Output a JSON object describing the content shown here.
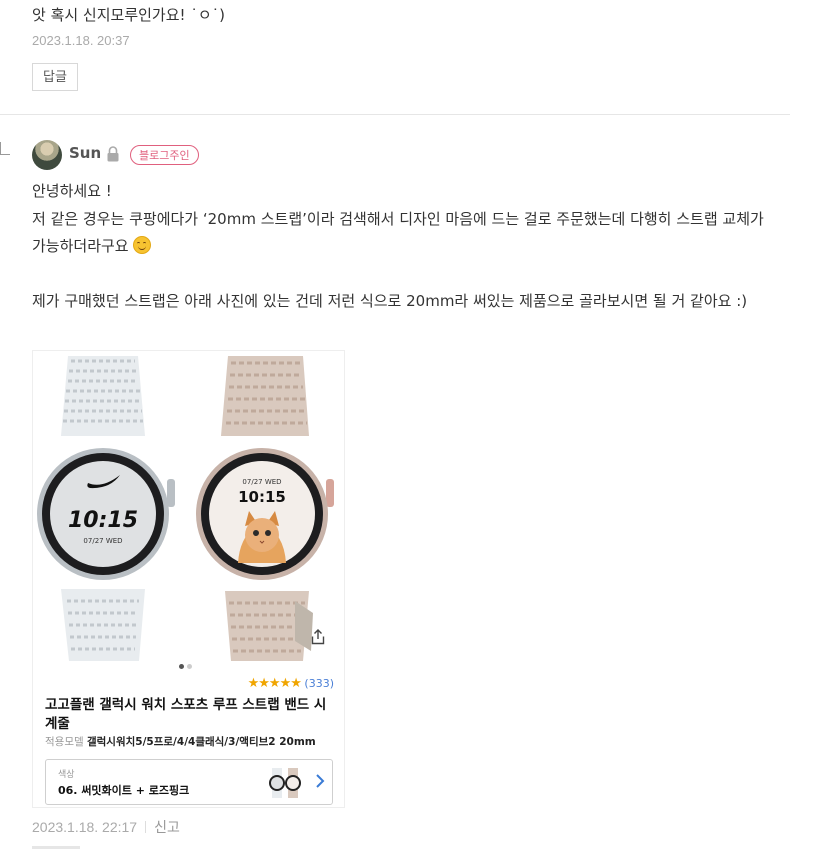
{
  "previous_comment": {
    "text": "앗 혹시 신지모루인가요! ˙ㅇ˙)",
    "timestamp": "2023.1.18. 20:37",
    "reply_label": "답글"
  },
  "reply": {
    "username": "Sun",
    "badge": "블로그주인",
    "lines": {
      "l1": "안녕하세요 !",
      "l2": "저 같은 경우는 쿠팡에다가 ‘20mm 스트랩’이라 검색해서 디자인 마음에 드는 걸로 주문했는데 다행히 스트랩 교체가 가능하더라구요",
      "l3": "제가 구매했던 스트랩은 아래 사진에 있는 건데 저런 식으로 20mm라 써있는 제품으로 골라보시면 될 거 같아요 :)"
    },
    "timestamp": "2023.1.18. 22:17",
    "report_label": "신고"
  },
  "product_card": {
    "left_watch_time": "10:15",
    "left_watch_date": "07/27 WED",
    "right_watch_date": "07/27 WED",
    "right_watch_time": "10:15",
    "rating_stars": "★★★★★",
    "review_count": "(333)",
    "title": "고고플랜 갤럭시 워치 스포츠 루프 스트랩 밴드 시계줄",
    "model_label": "적용모델",
    "model_value": "갤럭시워치5/5프로/4/4클래식/3/액티브2 20mm",
    "option_label": "색상",
    "option_value": "06. 써밋화이트 + 로즈핑크"
  },
  "colors": {
    "badge": "#e0607e",
    "star": "#f0a500",
    "review_count": "#4a7fd6"
  }
}
